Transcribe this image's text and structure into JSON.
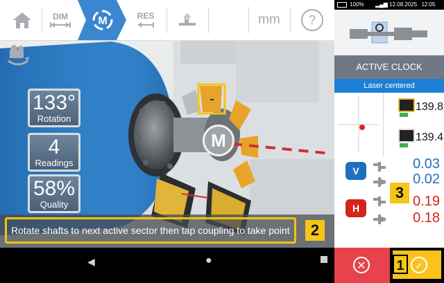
{
  "toolbar": {
    "items": [
      {
        "id": "home",
        "label": "",
        "icon": "home-icon"
      },
      {
        "id": "dim",
        "label": "DIM",
        "icon": "dimensions-arrows-icon"
      },
      {
        "id": "measure",
        "label": "",
        "icon": "measure-clock-icon",
        "active": true
      },
      {
        "id": "res",
        "label": "RES",
        "icon": "results-arrows-icon"
      },
      {
        "id": "tolerance",
        "label": "",
        "icon": "alignment-tolerance-icon"
      },
      {
        "id": "blank",
        "label": "",
        "icon": ""
      }
    ],
    "units": "mm",
    "help": "?"
  },
  "readouts": {
    "rotation": {
      "value": "133°",
      "label": "Rotation"
    },
    "readings": {
      "value": "4",
      "label": "Readings"
    },
    "quality": {
      "value": "58%",
      "label": "Quality"
    }
  },
  "coupling_label": "M",
  "status_message": "Rotate shafts to next active sector then tap coupling to take point",
  "callouts": {
    "status": "2",
    "results": "3",
    "ok": "1"
  },
  "system_bar": {
    "battery": "100%",
    "date": "12.08.2025",
    "time": "12:05"
  },
  "right_panel": {
    "mode_label": "ACTIVE CLOCK",
    "laser_status": "Laser centered",
    "sensor_values": {
      "top": "139.8",
      "bottom": "139.4"
    },
    "results": {
      "vertical": {
        "badge": "V",
        "offset": "0.03",
        "angularity": "0.02"
      },
      "horizontal": {
        "badge": "H",
        "offset": "0.19",
        "angularity": "0.18"
      }
    }
  },
  "colors": {
    "accent_blue": "#1c7fd6",
    "vertical_blue": "#1f6fbf",
    "horizontal_red": "#d3231e",
    "highlight_yellow": "#f5c518",
    "cancel_red": "#e8434c",
    "ok_yellow": "#f9c21d",
    "sector_orange": "#e8a42a"
  }
}
